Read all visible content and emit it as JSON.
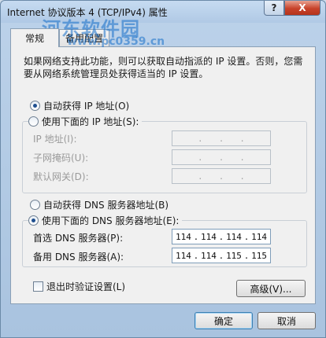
{
  "window": {
    "title": "Internet 协议版本 4 (TCP/IPv4) 属性",
    "help_label": "?",
    "close_label": "X"
  },
  "watermark": {
    "brand": "河东软件园",
    "url": "www.pc0359.cn"
  },
  "tabs": [
    {
      "label": "常规",
      "active": true
    },
    {
      "label": "备用配置",
      "active": false
    }
  ],
  "description": "如果网络支持此功能，则可以获取自动指派的 IP 设置。否则，您需要从网络系统管理员处获得适当的 IP 设置。",
  "ip_section": {
    "auto_label": "自动获得 IP 地址(O)",
    "auto_selected": true,
    "manual_label": "使用下面的 IP 地址(S):",
    "manual_selected": false,
    "fields": [
      {
        "label": "IP 地址(I):"
      },
      {
        "label": "子网掩码(U):"
      },
      {
        "label": "默认网关(D):"
      }
    ]
  },
  "dns_section": {
    "auto_label": "自动获得 DNS 服务器地址(B)",
    "auto_selected": false,
    "manual_label": "使用下面的 DNS 服务器地址(E):",
    "manual_selected": true,
    "preferred": {
      "label": "首选 DNS 服务器(P):",
      "octets": [
        "114",
        "114",
        "114",
        "114"
      ]
    },
    "alternate": {
      "label": "备用 DNS 服务器(A):",
      "octets": [
        "114",
        "114",
        "115",
        "115"
      ]
    }
  },
  "validate_label": "退出时验证设置(L)",
  "validate_checked": false,
  "advanced_label": "高级(V)...",
  "ok_label": "确定",
  "cancel_label": "取消",
  "colors": {
    "title_bar": "#b0c9e5",
    "close_button": "#c7422a",
    "panel": "#f0f0f0",
    "watermark": "#146ec8"
  }
}
